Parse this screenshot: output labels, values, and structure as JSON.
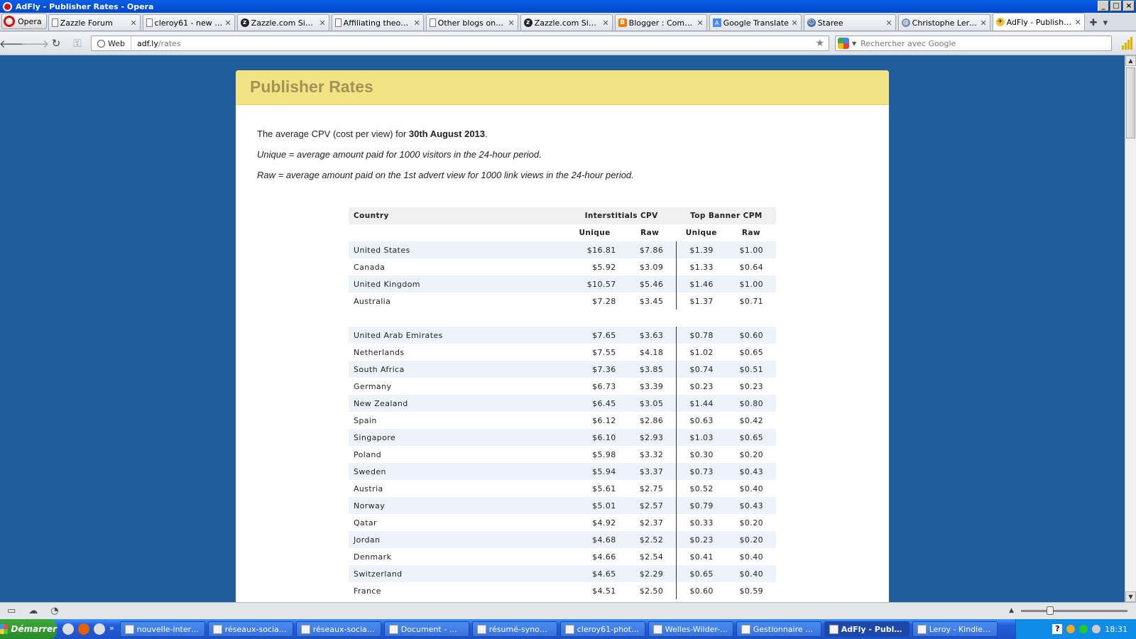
{
  "window": {
    "title": "AdFly - Publisher Rates - Opera"
  },
  "browser": {
    "menu_label": "Opera",
    "tabs": [
      {
        "label": "Zazzle Forum",
        "icon": "page-icon"
      },
      {
        "label": "cleroy61 - new u...",
        "icon": "page-icon"
      },
      {
        "label": "Zazzle.com Sign in",
        "icon": "zazzle-icon"
      },
      {
        "label": "Affiliating theory...",
        "icon": "page-icon"
      },
      {
        "label": "Other blogs on B...",
        "icon": "page-icon"
      },
      {
        "label": "Zazzle.com Sign in",
        "icon": "zazzle-icon"
      },
      {
        "label": "Blogger : Comme...",
        "icon": "blogger-icon"
      },
      {
        "label": "Google Translate",
        "icon": "translate-icon"
      },
      {
        "label": "Staree",
        "icon": "staree-icon"
      },
      {
        "label": "Christophe Lero...",
        "icon": "globe-icon"
      },
      {
        "label": "AdFly - Publisher...",
        "icon": "adfly-icon"
      }
    ],
    "address": {
      "mode": "Web",
      "host": "adf.ly",
      "path": "/rates"
    },
    "search_placeholder": "Rechercher avec Google"
  },
  "page": {
    "heading": "Publisher Rates",
    "intro_prefix": "The average CPV (cost per view) for ",
    "intro_date": "30th August 2013",
    "intro_suffix": ".",
    "unique_def": "Unique = average amount paid for 1000 visitors in the 24-hour period.",
    "raw_def": "Raw = average amount paid on the 1st advert view for 1000 link views in the 24-hour period.",
    "table": {
      "col_country": "Country",
      "col_interstitials": "Interstitials CPV",
      "col_banner": "Top Banner CPM",
      "sub_unique": "Unique",
      "sub_raw": "Raw",
      "group1": [
        [
          "United States",
          "$16.81",
          "$7.86",
          "$1.39",
          "$1.00"
        ],
        [
          "Canada",
          "$5.92",
          "$3.09",
          "$1.33",
          "$0.64"
        ],
        [
          "United Kingdom",
          "$10.57",
          "$5.46",
          "$1.46",
          "$1.00"
        ],
        [
          "Australia",
          "$7.28",
          "$3.45",
          "$1.37",
          "$0.71"
        ]
      ],
      "group2": [
        [
          "United Arab Emirates",
          "$7.65",
          "$3.63",
          "$0.78",
          "$0.60"
        ],
        [
          "Netherlands",
          "$7.55",
          "$4.18",
          "$1.02",
          "$0.65"
        ],
        [
          "South Africa",
          "$7.36",
          "$3.85",
          "$0.74",
          "$0.51"
        ],
        [
          "Germany",
          "$6.73",
          "$3.39",
          "$0.23",
          "$0.23"
        ],
        [
          "New Zealand",
          "$6.45",
          "$3.05",
          "$1.44",
          "$0.80"
        ],
        [
          "Spain",
          "$6.12",
          "$2.86",
          "$0.63",
          "$0.42"
        ],
        [
          "Singapore",
          "$6.10",
          "$2.93",
          "$1.03",
          "$0.65"
        ],
        [
          "Poland",
          "$5.98",
          "$3.32",
          "$0.30",
          "$0.20"
        ],
        [
          "Sweden",
          "$5.94",
          "$3.37",
          "$0.73",
          "$0.43"
        ],
        [
          "Austria",
          "$5.61",
          "$2.75",
          "$0.52",
          "$0.40"
        ],
        [
          "Norway",
          "$5.01",
          "$2.57",
          "$0.79",
          "$0.43"
        ],
        [
          "Qatar",
          "$4.92",
          "$2.37",
          "$0.33",
          "$0.20"
        ],
        [
          "Jordan",
          "$4.68",
          "$2.52",
          "$0.23",
          "$0.20"
        ],
        [
          "Denmark",
          "$4.66",
          "$2.54",
          "$0.41",
          "$0.40"
        ],
        [
          "Switzerland",
          "$4.65",
          "$2.29",
          "$0.65",
          "$0.40"
        ],
        [
          "France",
          "$4.51",
          "$2.50",
          "$0.60",
          "$0.59"
        ]
      ]
    }
  },
  "taskbar": {
    "start_label": "Démarrer",
    "tasks": [
      {
        "label": "nouvelle-interface",
        "active": false
      },
      {
        "label": "réseaux-sociaux....",
        "active": false
      },
      {
        "label": "réseaux-sociaux-...",
        "active": false
      },
      {
        "label": "Document - Wor...",
        "active": false
      },
      {
        "label": "résumé-synopsis...",
        "active": false
      },
      {
        "label": "cleroy61-photogr...",
        "active": false
      },
      {
        "label": "Welles-Wilder---...",
        "active": false
      },
      {
        "label": "Gestionnaire des ...",
        "active": false
      },
      {
        "label": "AdFly - Publish...",
        "active": true
      },
      {
        "label": "Leroy - Kindle po...",
        "active": false
      }
    ],
    "clock": "18:31"
  },
  "colors": {
    "page_bg": "#215d9c",
    "header_bg": "#f2e384",
    "heading": "#a09456"
  }
}
